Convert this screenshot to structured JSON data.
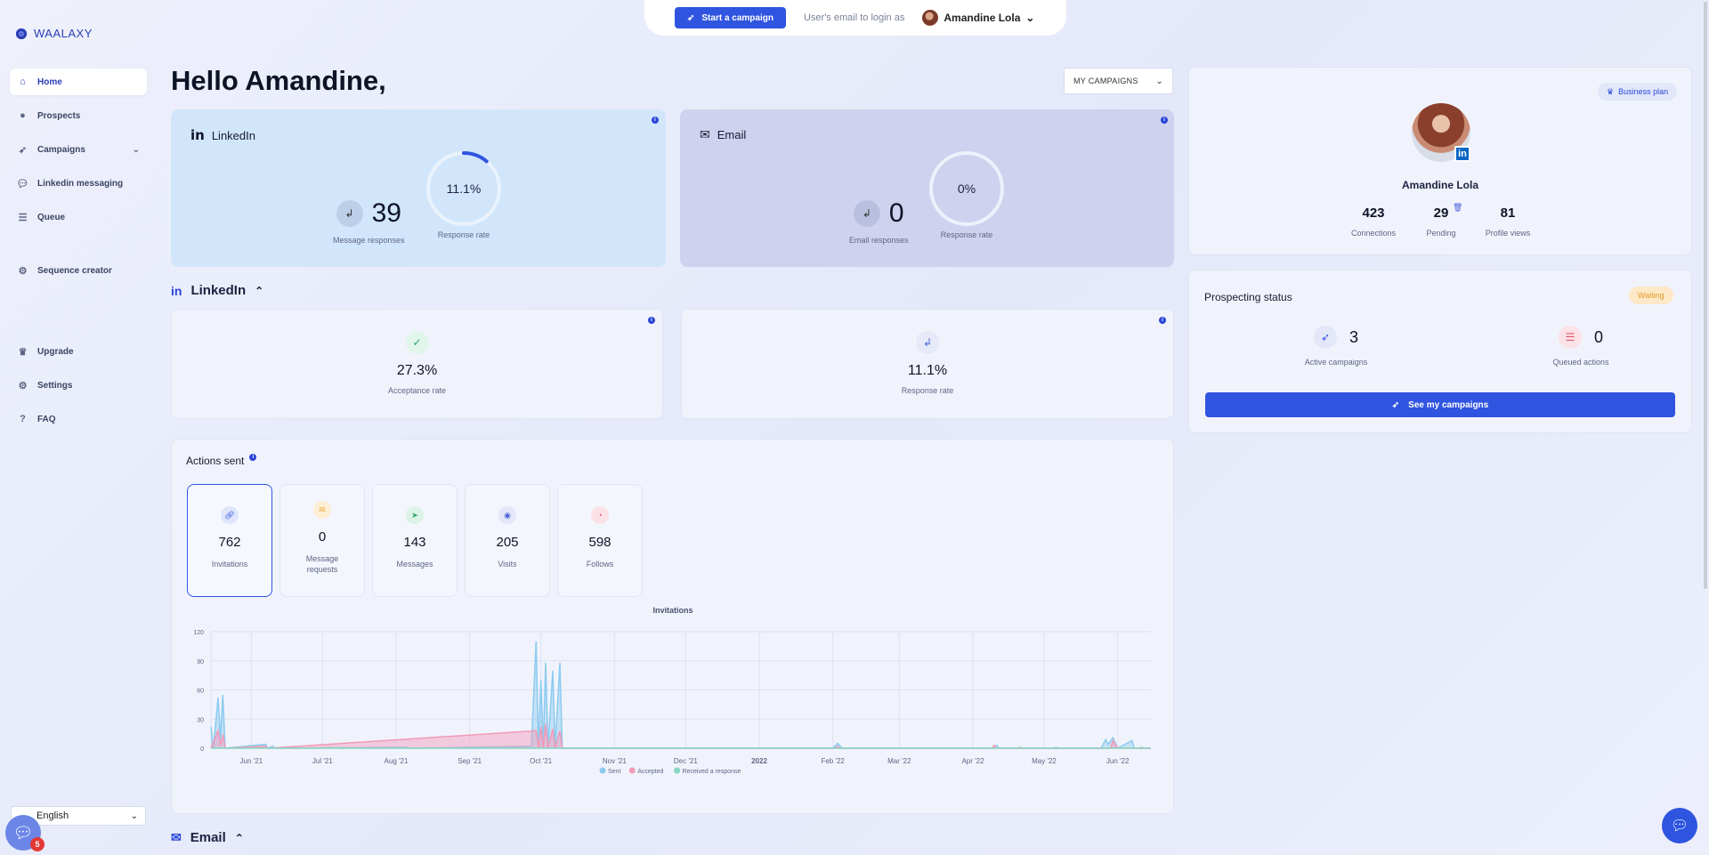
{
  "brand": {
    "name": "WAALAXY"
  },
  "sidebar": {
    "items": [
      {
        "label": "Home",
        "icon": "home-icon",
        "active": true
      },
      {
        "label": "Prospects",
        "icon": "users-icon"
      },
      {
        "label": "Campaigns",
        "icon": "rocket-icon",
        "expandable": true
      },
      {
        "label": "Linkedin messaging",
        "icon": "chat-icon"
      },
      {
        "label": "Queue",
        "icon": "queue-icon"
      },
      {
        "label": "Sequence creator",
        "icon": "gear-icon"
      },
      {
        "label": "Upgrade",
        "icon": "crown-icon"
      },
      {
        "label": "Settings",
        "icon": "gear-icon"
      },
      {
        "label": "FAQ",
        "icon": "help-icon"
      }
    ],
    "language": "English",
    "chat_badge": "5"
  },
  "topbar": {
    "start_campaign": "Start a campaign",
    "login_as": "User's email to login as",
    "user_name": "Amandine Lola"
  },
  "main": {
    "greeting": "Hello Amandine,",
    "campaign_filter": "MY CAMPAIGNS",
    "linkedin_card": {
      "title": "LinkedIn",
      "responses_value": "39",
      "responses_label": "Message responses",
      "rate_value": "11.1%",
      "rate_fraction": 0.111,
      "rate_label": "Response rate"
    },
    "email_card": {
      "title": "Email",
      "responses_value": "0",
      "responses_label": "Email responses",
      "rate_value": "0%",
      "rate_fraction": 0,
      "rate_label": "Response rate"
    },
    "linkedin_section": {
      "title": "LinkedIn",
      "acceptance_value": "27.3%",
      "acceptance_label": "Acceptance rate",
      "response_value": "11.1%",
      "response_label": "Response rate"
    },
    "actions": {
      "title": "Actions sent",
      "tiles": [
        {
          "value": "762",
          "label": "Invitations",
          "icon": "link-icon",
          "color": "#2f54e0"
        },
        {
          "value": "0",
          "label": "Message requests",
          "icon": "envelope-icon",
          "color": "#f0a53a"
        },
        {
          "value": "143",
          "label": "Messages",
          "icon": "send-icon",
          "color": "#27a96b"
        },
        {
          "value": "205",
          "label": "Visits",
          "icon": "eye-icon",
          "color": "#4a63d9"
        },
        {
          "value": "598",
          "label": "Follows",
          "icon": "rss-icon",
          "color": "#e5536a"
        }
      ]
    },
    "email_section": {
      "title": "Email"
    }
  },
  "chart_data": {
    "type": "area",
    "title": "Invitations",
    "ylim": [
      0,
      120
    ],
    "yticks": [
      0,
      30,
      60,
      90,
      120
    ],
    "xticks": [
      "Jun '21",
      "Jul '21",
      "Aug '21",
      "Sep '21",
      "Oct '21",
      "Nov '21",
      "Dec '21",
      "2022",
      "Feb '22",
      "Mar '22",
      "Apr '22",
      "May '22",
      "Jun '22"
    ],
    "x_start": "2021-05-15",
    "x_end": "2022-06-15",
    "legend_placement": "bottom",
    "series": [
      {
        "name": "Sent",
        "color": "#8ccbf0",
        "points": [
          [
            "2021-05-15",
            22
          ],
          [
            "2021-05-16",
            0
          ],
          [
            "2021-05-18",
            52
          ],
          [
            "2021-05-19",
            10
          ],
          [
            "2021-05-20",
            55
          ],
          [
            "2021-05-21",
            0
          ],
          [
            "2021-06-07",
            4
          ],
          [
            "2021-06-08",
            0
          ],
          [
            "2021-06-10",
            2
          ],
          [
            "2021-06-11",
            0
          ],
          [
            "2021-08-05",
            1
          ],
          [
            "2021-08-06",
            0
          ],
          [
            "2021-09-27",
            2
          ],
          [
            "2021-09-29",
            110
          ],
          [
            "2021-09-30",
            0
          ],
          [
            "2021-10-01",
            70
          ],
          [
            "2021-10-02",
            0
          ],
          [
            "2021-10-03",
            88
          ],
          [
            "2021-10-04",
            0
          ],
          [
            "2021-10-06",
            80
          ],
          [
            "2021-10-07",
            0
          ],
          [
            "2021-10-09",
            88
          ],
          [
            "2021-10-10",
            0
          ],
          [
            "2022-02-01",
            0
          ],
          [
            "2022-02-03",
            5
          ],
          [
            "2022-02-05",
            0
          ],
          [
            "2022-04-10",
            0
          ],
          [
            "2022-04-11",
            3
          ],
          [
            "2022-04-12",
            0
          ],
          [
            "2022-05-25",
            0
          ],
          [
            "2022-05-27",
            9
          ],
          [
            "2022-05-28",
            4
          ],
          [
            "2022-05-30",
            11
          ],
          [
            "2022-06-01",
            0
          ],
          [
            "2022-06-07",
            8
          ],
          [
            "2022-06-08",
            0
          ]
        ]
      },
      {
        "name": "Accepted",
        "color": "#f29ab8",
        "points": [
          [
            "2021-05-15",
            0
          ],
          [
            "2021-05-18",
            18
          ],
          [
            "2021-05-19",
            3
          ],
          [
            "2021-05-20",
            14
          ],
          [
            "2021-05-21",
            0
          ],
          [
            "2021-06-07",
            2
          ],
          [
            "2021-06-08",
            0
          ],
          [
            "2021-09-29",
            18
          ],
          [
            "2021-09-30",
            0
          ],
          [
            "2021-10-01",
            22
          ],
          [
            "2021-10-02",
            0
          ],
          [
            "2021-10-03",
            25
          ],
          [
            "2021-10-04",
            0
          ],
          [
            "2021-10-06",
            20
          ],
          [
            "2021-10-07",
            0
          ],
          [
            "2021-10-09",
            18
          ],
          [
            "2021-10-10",
            0
          ],
          [
            "2022-02-02",
            0
          ],
          [
            "2022-02-03",
            2
          ],
          [
            "2022-02-04",
            0
          ],
          [
            "2022-04-09",
            0
          ],
          [
            "2022-04-10",
            3
          ],
          [
            "2022-04-11",
            0
          ],
          [
            "2022-05-29",
            0
          ],
          [
            "2022-05-30",
            8
          ],
          [
            "2022-06-01",
            0
          ]
        ]
      },
      {
        "name": "Received a response",
        "color": "#86d6c0",
        "points": [
          [
            "2021-05-15",
            0
          ],
          [
            "2022-04-20",
            0
          ],
          [
            "2022-04-21",
            1
          ],
          [
            "2022-04-22",
            0
          ],
          [
            "2022-05-05",
            0
          ],
          [
            "2022-05-06",
            1
          ],
          [
            "2022-05-07",
            0
          ],
          [
            "2022-06-10",
            0
          ],
          [
            "2022-06-11",
            1
          ],
          [
            "2022-06-12",
            0
          ]
        ]
      }
    ]
  },
  "profile": {
    "plan": "Business plan",
    "name": "Amandine Lola",
    "connections": "423",
    "connections_label": "Connections",
    "pending": "29",
    "pending_label": "Pending",
    "views": "81",
    "views_label": "Profile views"
  },
  "prospecting": {
    "title": "Prospecting status",
    "status": "Waiting",
    "active_value": "3",
    "active_label": "Active campaigns",
    "queued_value": "0",
    "queued_label": "Queued actions",
    "button": "See my campaigns"
  }
}
